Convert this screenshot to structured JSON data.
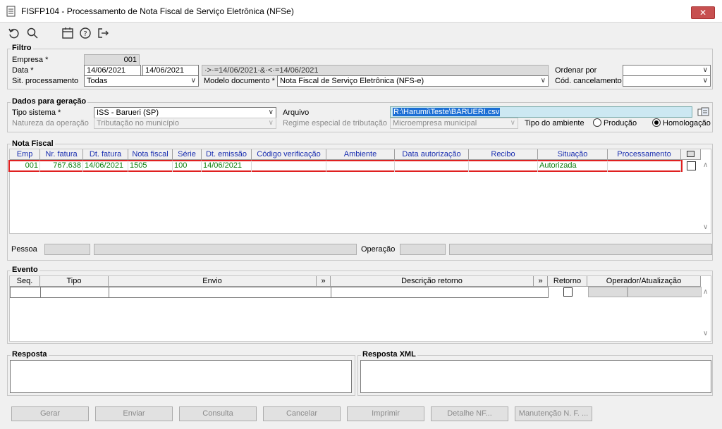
{
  "window": {
    "title": "FISFP104 - Processamento de Nota Fiscal de Serviço Eletrônica (NFSe)",
    "close": "✕"
  },
  "toolbar": {
    "undo": "undo-icon",
    "search": "search-icon",
    "calendar": "calendar-icon",
    "help": "help-icon",
    "exit": "exit-icon"
  },
  "filtro": {
    "title": "Filtro",
    "empresa_label": "Empresa *",
    "empresa_value": "001",
    "data_label": "Data *",
    "data_de": "14/06/2021",
    "data_ate": "14/06/2021",
    "data_expr": "·>·=14/06/2021·&·<·=14/06/2021",
    "sit_label": "Sit. processamento",
    "sit_value": "Todas",
    "modelo_label": "Modelo documento *",
    "modelo_value": "Nota Fiscal de Serviço Eletrônica (NFS-e)",
    "ordenar_label": "Ordenar por",
    "ordenar_value": "",
    "cod_canc_label": "Cód. cancelamento",
    "cod_canc_value": ""
  },
  "dados": {
    "title": "Dados para geração",
    "tipo_sistema_label": "Tipo sistema *",
    "tipo_sistema_value": "ISS - Barueri (SP)",
    "natureza_label": "Natureza da operação",
    "natureza_value": "Tributação no município",
    "arquivo_label": "Arquivo",
    "arquivo_value": "R:\\Harumi\\Teste\\BARUERI.csv",
    "regime_label": "Regime especial de tributação",
    "regime_value": "Microempresa municipal",
    "tipo_ambiente_label": "Tipo do ambiente",
    "producao_label": "Produção",
    "homologacao_label": "Homologação"
  },
  "nota_fiscal": {
    "title": "Nota Fiscal",
    "columns": [
      "Emp",
      "Nr. fatura",
      "Dt. fatura",
      "Nota fiscal",
      "Série",
      "Dt. emissão",
      "Código verificação",
      "Ambiente",
      "Data autorização",
      "Recibo",
      "Situação",
      "Processamento"
    ],
    "rows": [
      {
        "emp": "001",
        "nr_fatura": "767.638",
        "dt_fatura": "14/06/2021",
        "nota_fiscal": "1505",
        "serie": "100",
        "dt_emissao": "14/06/2021",
        "codigo": "",
        "ambiente": "",
        "data_aut": "",
        "recibo": "",
        "situacao": "Autorizada",
        "processamento": ""
      }
    ],
    "pessoa_label": "Pessoa",
    "operacao_label": "Operação"
  },
  "evento": {
    "title": "Evento",
    "columns": [
      "Seq.",
      "Tipo",
      "Envio",
      "»",
      "Descrição retorno",
      "»",
      "Retorno",
      "Operador/Atualização"
    ]
  },
  "resposta": {
    "title": "Resposta",
    "xml_title": "Resposta XML"
  },
  "buttons": {
    "gerar": "Gerar",
    "enviar": "Enviar",
    "consulta": "Consulta",
    "cancelar": "Cancelar",
    "imprimir": "Imprimir",
    "detalhe": "Detalhe NF...",
    "manutencao": "Manutenção N. F. ..."
  }
}
